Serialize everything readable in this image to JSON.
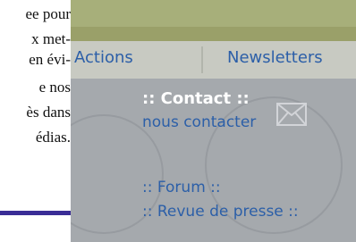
{
  "left_text": {
    "lines": [
      "ee pour",
      "x met-",
      "en évi-",
      "e nos",
      "ès dans",
      "édias."
    ]
  },
  "nav": {
    "actions": "Actions",
    "newsletters": "Newsletters"
  },
  "contact": {
    "title": ":: Contact ::",
    "link": "nous contacter"
  },
  "menu": {
    "forum": ":: Forum ::",
    "press": ":: Revue de presse ::"
  },
  "colors": {
    "link": "#2c5fa8",
    "arrow": "#3a2d96",
    "top_band": "#a7af7a",
    "nav_bg": "#c8cac2",
    "content_bg": "#a5a9ad"
  },
  "icons": {
    "arrow": "right-arrow-icon",
    "mail": "envelope-icon"
  }
}
